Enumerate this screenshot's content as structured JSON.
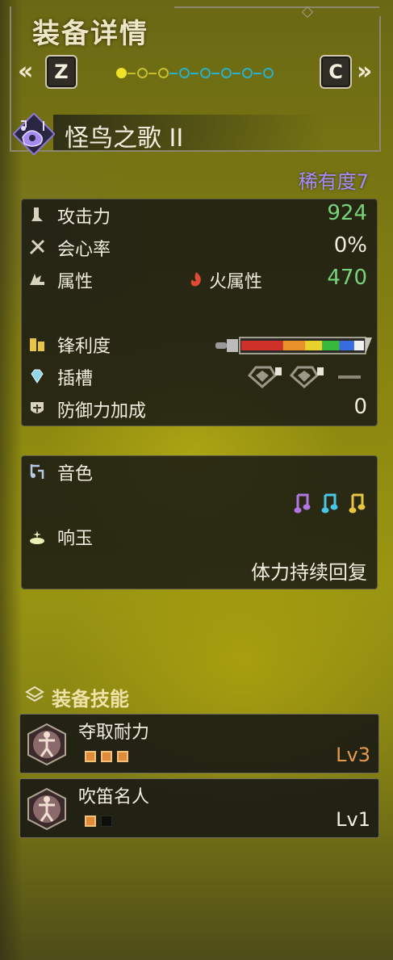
{
  "header": {
    "title": "装备详情",
    "prev_arrow": "«",
    "next_arrow": "»",
    "prev_key": "Z",
    "next_key": "C",
    "page_count": 8,
    "current_page": 1
  },
  "weapon": {
    "icon": "hunting-horn-icon",
    "name": "怪鸟之歌 II",
    "rarity": "稀有度7",
    "rarity_color": "#a78bff"
  },
  "stats": {
    "attack_label": "攻击力",
    "attack_value": "924",
    "affinity_label": "会心率",
    "affinity_value": "0%",
    "element_label": "属性",
    "element_type": "火属性",
    "element_value": "470",
    "sharpness_label": "锋利度",
    "sharpness_levels": [
      {
        "color": "#d0302a",
        "fraction": 0.34
      },
      {
        "color": "#e8902a",
        "fraction": 0.18
      },
      {
        "color": "#e8d12a",
        "fraction": 0.14
      },
      {
        "color": "#36b93d",
        "fraction": 0.14
      },
      {
        "color": "#3a6ae0",
        "fraction": 0.12
      },
      {
        "color": "#f0f0f0",
        "fraction": 0.08
      }
    ],
    "slots_label": "插槽",
    "defense_label": "防御力加成",
    "defense_value": "0",
    "value_green": "#77d47a"
  },
  "melody": {
    "notes_label": "音色",
    "note_colors": [
      "#b276e6",
      "#48c6e8",
      "#e8c542"
    ],
    "echo_label": "响玉",
    "echo_value": "体力持续回复"
  },
  "skills": {
    "section_label": "装备技能",
    "items": [
      {
        "name": "夺取耐力",
        "level": "Lv3",
        "filled": 3,
        "total": 3,
        "level_color": "#e59a4e"
      },
      {
        "name": "吹笛名人",
        "level": "Lv1",
        "filled": 1,
        "total": 2,
        "level_color": "#f2ede0"
      }
    ]
  }
}
